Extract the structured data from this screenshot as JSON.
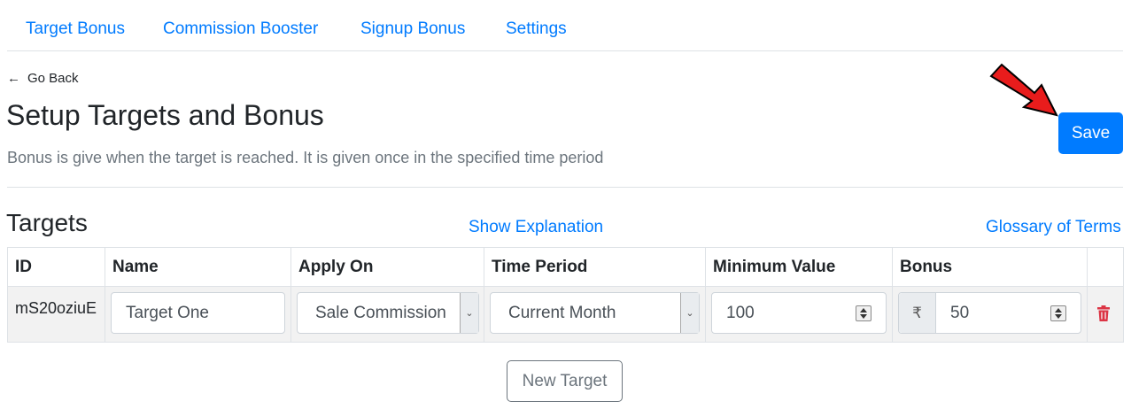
{
  "nav": {
    "tabs": [
      {
        "label": "Target Bonus"
      },
      {
        "label": "Commission Booster"
      },
      {
        "label": "Signup Bonus"
      },
      {
        "label": "Settings"
      }
    ]
  },
  "header": {
    "back_arrow": "←",
    "back_label": "Go Back",
    "title": "Setup Targets and Bonus",
    "subtitle": "Bonus is give when the target is reached. It is given once in the specified time period",
    "save_label": "Save"
  },
  "targets": {
    "title": "Targets",
    "show_explanation": "Show Explanation",
    "glossary": "Glossary of Terms",
    "columns": [
      "ID",
      "Name",
      "Apply On",
      "Time Period",
      "Minimum Value",
      "Bonus"
    ],
    "rows": [
      {
        "id": "mS20oziuE",
        "name": "Target One",
        "apply_on": "Sale Commission",
        "time_period": "Current Month",
        "minimum_value": "100",
        "currency_symbol": "₹",
        "bonus": "50"
      }
    ],
    "new_target_label": "New Target"
  },
  "colors": {
    "accent": "#007bff",
    "delete": "#dc3545",
    "annotation_arrow": "#e81c1c"
  },
  "icons": {
    "back": "left-arrow-icon",
    "select": "chevron-down-icon",
    "delete": "trash-icon",
    "annotation": "red-pointer-arrow"
  }
}
